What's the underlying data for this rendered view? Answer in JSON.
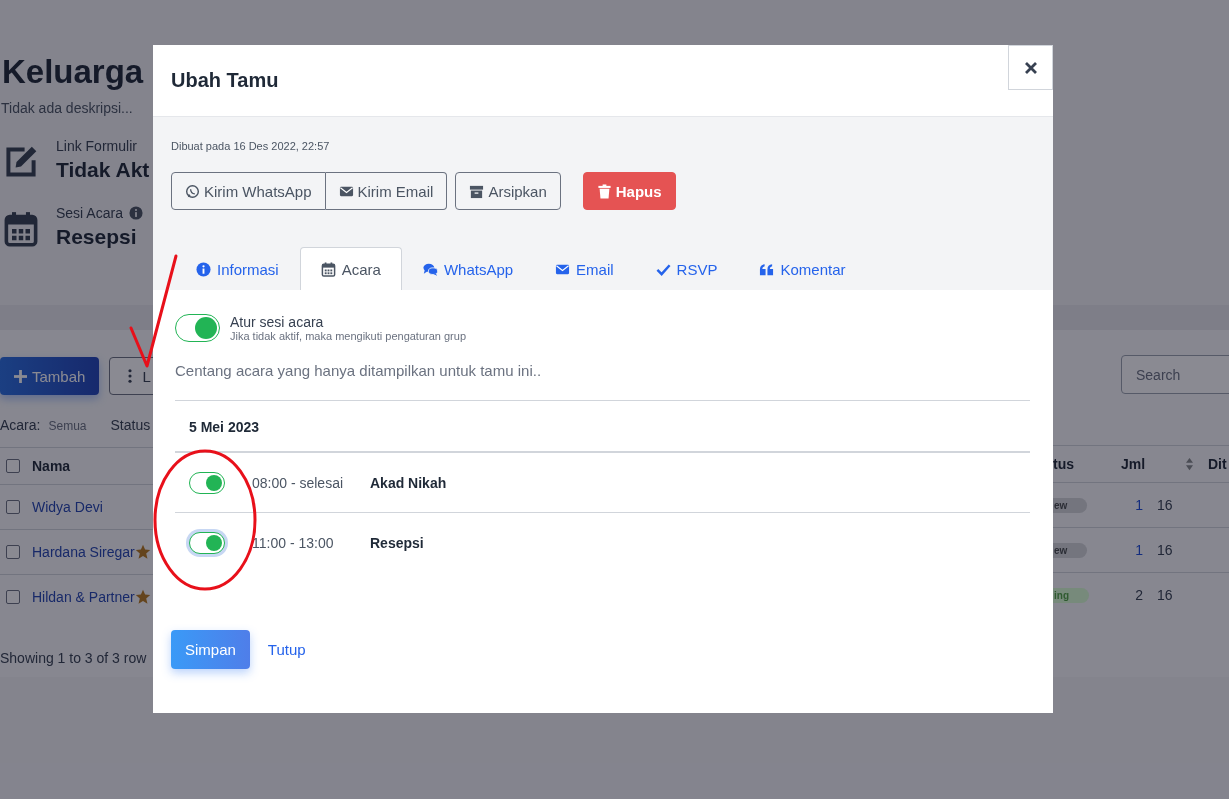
{
  "page": {
    "title": "Keluarga",
    "description": "Tidak ada deskripsi...",
    "details": [
      {
        "kind": "edit",
        "label": "Link Formulir",
        "value": "Tidak Akt",
        "info": false
      },
      {
        "kind": "calendar",
        "label": "Sesi Acara",
        "value": "Resepsi",
        "info": true
      }
    ]
  },
  "toolbar": {
    "add_button": "Tambah",
    "menu_button": "L"
  },
  "filters": [
    {
      "label": "Acara:",
      "value": "Semua"
    },
    {
      "label": "Status"
    }
  ],
  "search": {
    "placeholder": "Search"
  },
  "table": {
    "columns": [
      {
        "label": "Nama"
      },
      {
        "label": "tus",
        "sortable": false
      },
      {
        "label": "Jml",
        "sortable": true
      },
      {
        "label": "Dit",
        "sortable": false
      }
    ],
    "rows": [
      {
        "checked": false,
        "name": "Widya Devi",
        "starred": false,
        "status": "ew",
        "color": "#74757e",
        "count": "1",
        "date": "16"
      },
      {
        "checked": false,
        "name": "Hardana Siregar",
        "starred": true,
        "status": "ew",
        "color": "#74757e",
        "count": "1",
        "date": "16"
      },
      {
        "checked": false,
        "name": "Hildan & Partner",
        "starred": true,
        "status": "ing",
        "color": "#778a7b",
        "count": "2",
        "date": "16"
      }
    ],
    "all_checked": false,
    "footer": "Showing 1 to 3 of 3 row"
  },
  "modal": {
    "title": "Ubah Tamu",
    "created": "Dibuat pada 16 Des 2022, 22:57",
    "actions": [
      {
        "kind": "whatsapp",
        "label": "Kirim WhatsApp"
      },
      {
        "kind": "email",
        "label": "Kirim Email"
      },
      {
        "kind": "archive",
        "label": "Arsipkan"
      },
      {
        "kind": "delete",
        "label": "Hapus"
      }
    ],
    "tabs": [
      {
        "kind": "info",
        "label": "Informasi",
        "selected": false
      },
      {
        "kind": "calendar",
        "label": "Acara",
        "selected": true
      },
      {
        "kind": "chat",
        "label": "WhatsApp",
        "selected": false
      },
      {
        "kind": "email",
        "label": "Email",
        "selected": false
      },
      {
        "kind": "check",
        "label": "RSVP",
        "selected": false
      },
      {
        "kind": "quote",
        "label": "Komentar",
        "selected": false
      }
    ],
    "session_toggle": {
      "label": "Atur sesi acara",
      "hint": "Jika tidak aktif, maka mengikuti pengaturan grup",
      "on": true
    },
    "instruction": "Centang acara yang hanya ditampilkan untuk tamu ini..",
    "date": "5 Mei 2023",
    "events": [
      {
        "time": "08:00 - selesai",
        "name": "Akad Nikah",
        "on": true,
        "focused": false
      },
      {
        "time": "11:00 - 13:00",
        "name": "Resepsi",
        "on": true,
        "focused": true
      }
    ],
    "buttons": [
      {
        "kind": "primary",
        "label": "Simpan"
      },
      {
        "kind": "link",
        "label": "Tutup"
      }
    ]
  }
}
